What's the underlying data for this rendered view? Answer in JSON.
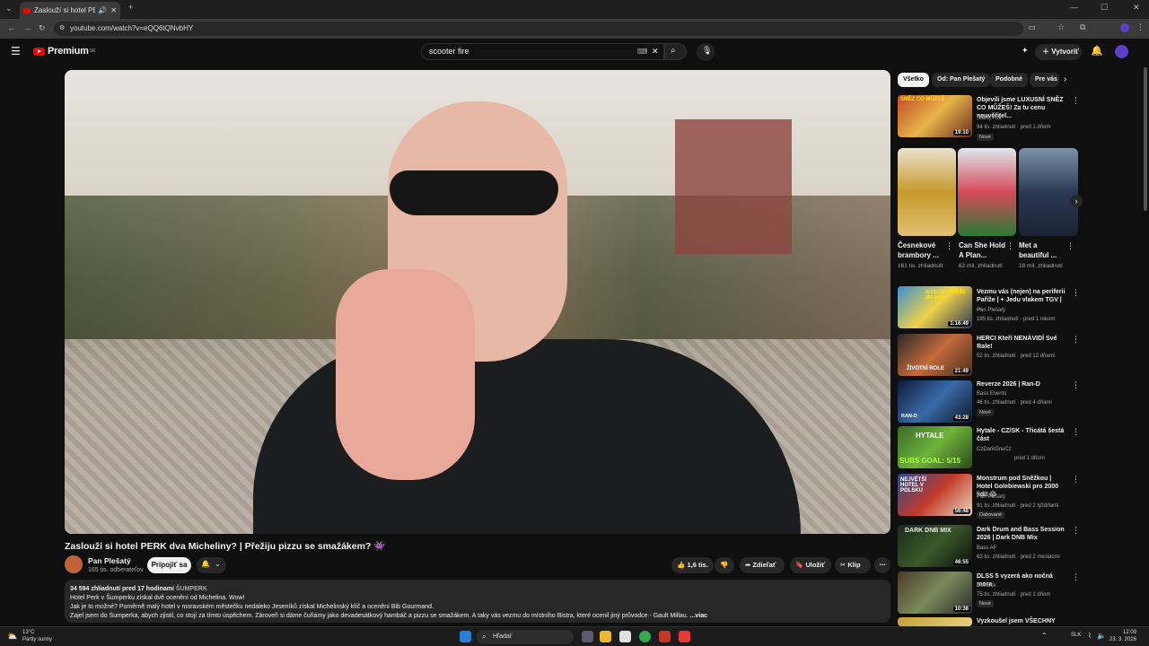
{
  "browser": {
    "tab_title": "Zaslouží si hotel PERK dva M",
    "url": "youtube.com/watch?v=eQQ6tQNvbHY"
  },
  "header": {
    "logo_text": "Premium",
    "logo_sup": "SK",
    "search_query": "scooter fire",
    "create_label": "Vytvoriť"
  },
  "video": {
    "title": "Zaslouží si hotel PERK dva Micheliny? | Přežiju pizzu se smažákem? 👾",
    "channel": "Pan Plešatý",
    "subscribers": "165 tis. odberateľov",
    "subscribe_label": "Pripojiť sa",
    "likes": "1,6 tis.",
    "share_label": "Zdieľať",
    "save_label": "Uložiť",
    "clip_label": "Klip"
  },
  "description": {
    "stats": "34 594 zhliadnutí  pred 17 hodinami",
    "location": "ŠUMPERK",
    "line1": "Hotel Perk v Šumperku získal dvě ocenění od Michelina. Wow!",
    "line2": "Jak je to možné? Poměrně malý hotel v moravském městečku nedaleko Jeseníků získal Michelinský klíč a ocenění Bib Gourmand.",
    "line3": "Zajel jsem do Šumperka, abych zjistil, co stojí za tímto úspěchem. Zároveň si dáme čuňámy jako devadesátkový hambáč a pizzu se smažákem. A taky vás vezmu do místního Bistra, které ocenil jiný průvodce - Gault Millau.",
    "more": "...viac"
  },
  "chips": [
    "Všetko",
    "Od: Pan Plešatý",
    "Podobné",
    "Pre vás"
  ],
  "shorts": [
    {
      "title": "Česnekové brambory ...",
      "views": "161 tis. zhliadnutí"
    },
    {
      "title": "Can She Hold A Plan...",
      "views": "62 mil. zhliadnutí"
    },
    {
      "title": "Met a beautiful ...",
      "views": "18 mil. zhliadnutí"
    }
  ],
  "recommended": [
    {
      "title": "Objevili jsme LUXUSNÍ SNĚZ CO MŮŽEŠ! Za tu cenu neuvěřitel...",
      "channel": "Starej Fotr",
      "meta": "94 tis. zhliadnutí · pred 1 dňom",
      "badge": "Nové",
      "duration": "19:10"
    },
    {
      "title": "Vezmu vás (nejen) na periferii Paříže | + Jedu vlakem TGV | ...",
      "channel": "Pan Plešatý",
      "meta": "185 tis. zhliadnutí · pred 1 rokom",
      "badge": "",
      "duration": "1:16:49"
    },
    {
      "title": "HERCI Kteří NENÁVIDÍ Své Role!",
      "channel": "Lük",
      "meta": "52 tis. zhliadnutí · pred 12 dňami",
      "badge": "",
      "duration": "21:49"
    },
    {
      "title": "Reverze 2026 | Ran-D",
      "channel": "Bass Events",
      "meta": "46 tis. zhliadnutí · pred 4 dňami",
      "badge": "Nové",
      "duration": "43:28"
    },
    {
      "title": "Hytale - CZ/SK - Třicátá šestá část",
      "channel": "CzDarkOneCz",
      "meta": "pred 1 dňom",
      "badge": "",
      "duration": ""
    },
    {
      "title": "Monstrum pod Sněžkou | Hotel Golebiewski pro 2000 lidí! 😱",
      "channel": "Pan Plešatý",
      "meta": "91 tis. zhliadnutí · pred 2 týždňami",
      "badge": "Dabované",
      "duration": "56:48"
    },
    {
      "title": "Dark Drum and Bass Session 2026 | Dark DNB Mix",
      "channel": "Bass AF",
      "meta": "63 tis. zhliadnutí · pred 2 mesiacmi",
      "badge": "",
      "duration": "46:55"
    },
    {
      "title": "DLSS 5 vyzerá ako nočná mora",
      "channel": "Dukiock",
      "meta": "75 tis. zhliadnutí · pred 1 dňom",
      "badge": "Nové",
      "duration": "10:38"
    },
    {
      "title": "Vyzkoušel jsem VŠECHNY",
      "channel": "",
      "meta": "",
      "badge": "",
      "duration": ""
    }
  ],
  "thumb_texts": {
    "t1": "SNĚZ CO MŮŽEŠ",
    "t2": "JEDU DO PAŘÍŽE 320 km/h",
    "t3": "ŽIVOTNÍ ROLE",
    "t5": "SUBS GOAL: 5/15",
    "t6": "NEJVĚTŠÍ HOTEL V POLSKU",
    "t7": "DARK DNB MIX",
    "t5b": "HYTALE",
    "t4": "RAN-D"
  },
  "taskbar": {
    "search_placeholder": "Hľadať",
    "weather_temp": "13°C",
    "weather_desc": "Partly sunny",
    "lang": "SLK",
    "time": "12:09",
    "date": "23. 3. 2026"
  },
  "colors": {
    "bg": "#0f0f0f",
    "brand_red": "#ff0000",
    "chip_bg": "#272727"
  }
}
